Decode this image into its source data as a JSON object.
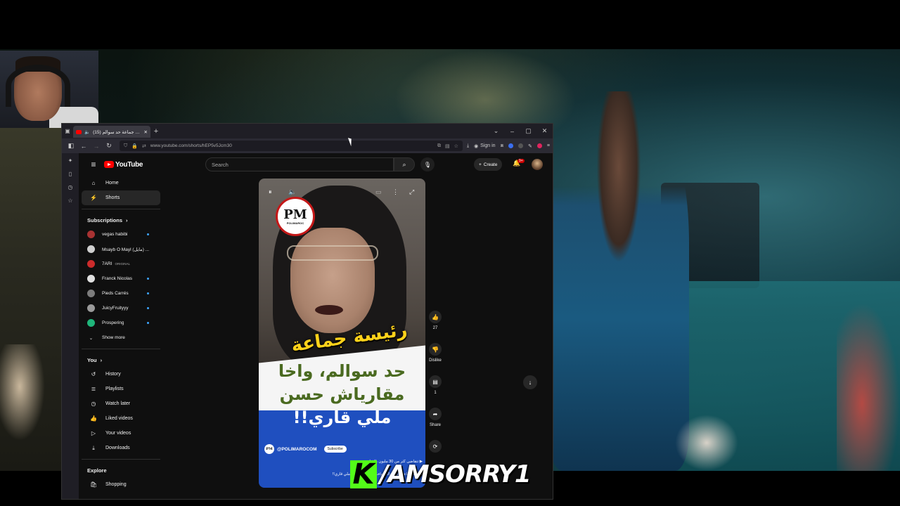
{
  "browser": {
    "tab_title": "(15) رئيسة جماعة حد سوالم...",
    "new_tab": "+",
    "url": "www.youtube.com/shorts/hEP5v5Jcm30",
    "sign_in": "Sign in",
    "window_controls": [
      "⌄",
      "–",
      "▢",
      "✕"
    ]
  },
  "youtube": {
    "logo_text": "YouTube",
    "search_placeholder": "Search",
    "create_label": "Create",
    "bell_badge": "9+",
    "nav": [
      {
        "label": "Home",
        "icon": "home-icon"
      },
      {
        "label": "Shorts",
        "icon": "shorts-icon"
      }
    ],
    "subscriptions_title": "Subscriptions",
    "subscriptions": [
      {
        "name": "vegas habibi",
        "color": "#a83232"
      },
      {
        "name": "Msayb O Mayl (مايل) ...",
        "color": "#cfcfcf"
      },
      {
        "name": "7ARI",
        "tag": "ORIGINAL",
        "color": "#cc2b2b"
      },
      {
        "name": "Franck Nicolas",
        "color": "#e0e0e0"
      },
      {
        "name": "Pieds Carrés",
        "color": "#7c7c7c"
      },
      {
        "name": "JuicyFruityyy",
        "color": "#9a9a9a"
      },
      {
        "name": "Prospering",
        "color": "#1fb57a"
      }
    ],
    "show_more": "Show more",
    "you_title": "You",
    "you_items": [
      {
        "label": "History",
        "icon": "history-icon"
      },
      {
        "label": "Playlists",
        "icon": "playlists-icon"
      },
      {
        "label": "Watch later",
        "icon": "watch-later-icon"
      },
      {
        "label": "Liked videos",
        "icon": "liked-icon"
      },
      {
        "label": "Your videos",
        "icon": "your-videos-icon"
      },
      {
        "label": "Downloads",
        "icon": "downloads-icon"
      }
    ],
    "explore_title": "Explore",
    "explore_items": [
      {
        "label": "Shopping",
        "icon": "shopping-icon"
      }
    ]
  },
  "short": {
    "logo_initials": "PM",
    "logo_name": "POLIMAROC",
    "overlay_line1": "رئيسة جماعة",
    "overlay_line2": "حد سوالم، واخا",
    "overlay_line3": "مقارياش حسن",
    "overlay_line4": "ملي قاري!!",
    "channel": "@POLIMAROCOM",
    "subscribe": "Subscribe",
    "desc_line1": "تتقاضى كثر من 30 مليون بالشانتي",
    "desc_line2": "رئيسة جماعة حد سوالم، واخا مقارياش حسن ملي قاري!!"
  },
  "actions": {
    "likes": "27",
    "dislike": "Dislike",
    "comments": "1",
    "share": "Share"
  },
  "overlay": {
    "k": "K",
    "handle": "/AMSORRY1"
  }
}
